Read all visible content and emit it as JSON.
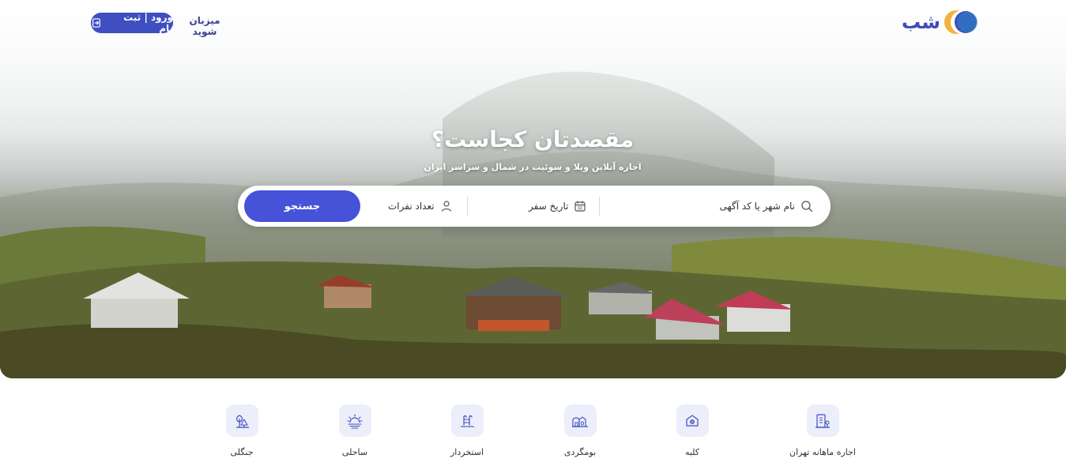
{
  "brand": {
    "name": "شب",
    "accent": "#3f4ec0",
    "button_color": "#4652d8"
  },
  "header": {
    "login_label": "ورود | ثبت نام",
    "login_icon": "login-icon",
    "host_label": "میزبان شوید"
  },
  "hero": {
    "title": "مقصدتان کجاست؟",
    "subtitle": "اجاره آنلاین ویلا و سوئیت در شمال و سراسر ایران"
  },
  "search": {
    "where_label": "نام شهر یا کد آگهی",
    "where_icon": "search-icon",
    "date_label": "تاریخ سفر",
    "date_icon": "calendar-icon",
    "guests_label": "تعداد نفرات",
    "guests_icon": "user-icon",
    "button_label": "جستجو"
  },
  "categories": [
    {
      "label": "اجاره ماهانه تهران",
      "icon": "building-icon"
    },
    {
      "label": "کلبه",
      "icon": "cabin-icon"
    },
    {
      "label": "بومگردی",
      "icon": "eco-house-icon"
    },
    {
      "label": "استخردار",
      "icon": "pool-ladder-icon"
    },
    {
      "label": "ساحلی",
      "icon": "beach-sun-icon"
    },
    {
      "label": "جنگلی",
      "icon": "forest-tree-icon"
    }
  ]
}
